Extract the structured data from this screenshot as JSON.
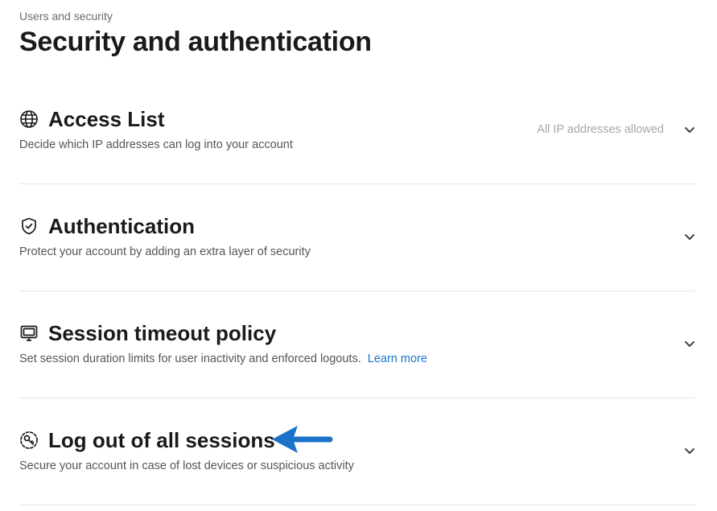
{
  "header": {
    "breadcrumb": "Users and security",
    "title": "Security and authentication"
  },
  "sections": [
    {
      "icon": "globe-icon",
      "title": "Access List",
      "description": "Decide which IP addresses can log into your account",
      "status": "All IP addresses allowed"
    },
    {
      "icon": "shield-check-icon",
      "title": "Authentication",
      "description": "Protect your account by adding an extra layer of security"
    },
    {
      "icon": "monitor-icon",
      "title": "Session timeout policy",
      "description": "Set session duration limits for user inactivity and enforced logouts.",
      "link": "Learn more"
    },
    {
      "icon": "logout-key-icon",
      "title": "Log out of all sessions",
      "description": "Secure your account in case of lost devices or suspicious activity"
    }
  ],
  "annotation": {
    "arrow_color": "#1a73c8",
    "arrow_icon": "arrow-left-icon"
  },
  "colors": {
    "link": "#1a73c8",
    "divider": "#e6e6e6",
    "muted": "#a8a8a8"
  }
}
